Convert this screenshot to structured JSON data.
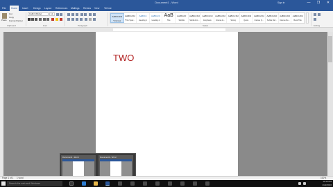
{
  "window": {
    "title": "Document1 - Word",
    "user": "Sign in",
    "controls": [
      "—",
      "❐",
      "✕"
    ]
  },
  "tabs": [
    "File",
    "Home",
    "Insert",
    "Design",
    "Layout",
    "References",
    "Mailings",
    "Review",
    "View",
    "Tell me"
  ],
  "active_tab": "Home",
  "ribbon": {
    "clipboard": {
      "paste": "Paste",
      "cut": "Cut",
      "copy": "Copy",
      "format_painter": "Format Painter",
      "label": "Clipboard"
    },
    "font": {
      "name": "Calibri (Body)",
      "size": "11",
      "label": "Font"
    },
    "paragraph": {
      "label": "Paragraph"
    },
    "styles": {
      "label": "Styles",
      "items": [
        {
          "sample": "AaBbCcDd",
          "name": "¶ Normal"
        },
        {
          "sample": "AaBbCcDd",
          "name": "¶ No Spac..."
        },
        {
          "sample": "AaBbCc",
          "name": "Heading 1"
        },
        {
          "sample": "AaBbCcC",
          "name": "Heading 2"
        },
        {
          "sample": "AaB",
          "name": "Title"
        },
        {
          "sample": "AaBbCcD",
          "name": "Subtitle"
        },
        {
          "sample": "AaBbCcDd",
          "name": "Subtle Em..."
        },
        {
          "sample": "AaBbCcDd",
          "name": "Emphasis"
        },
        {
          "sample": "AaBbCcDd",
          "name": "Intense E..."
        },
        {
          "sample": "AaBbCcDd",
          "name": "Strong"
        },
        {
          "sample": "AaBbCcDd",
          "name": "Quote"
        },
        {
          "sample": "AaBbCcDd",
          "name": "Intense Q..."
        },
        {
          "sample": "AaBbCcDd",
          "name": "Subtle Ref..."
        },
        {
          "sample": "AaBbCcDd",
          "name": "Intense Re..."
        },
        {
          "sample": "AaBbCcDd",
          "name": "Book Title"
        }
      ]
    },
    "editing": {
      "label": "Editing"
    }
  },
  "document": {
    "text": "TWO",
    "text_color": "#b01c1c"
  },
  "statusbar": {
    "page": "Page 1 of 1",
    "words": "1 word",
    "zoom": "100%"
  },
  "taskbar": {
    "search_placeholder": "Search the web and Windows",
    "time": "11:25 PM",
    "date": "4/22/2016"
  },
  "thumbnails": [
    {
      "caption": "Document1 - Word"
    },
    {
      "caption": "Document2 - Word"
    }
  ],
  "colors": {
    "accent": "#2b579a",
    "canvas": "#8a8a8a"
  }
}
